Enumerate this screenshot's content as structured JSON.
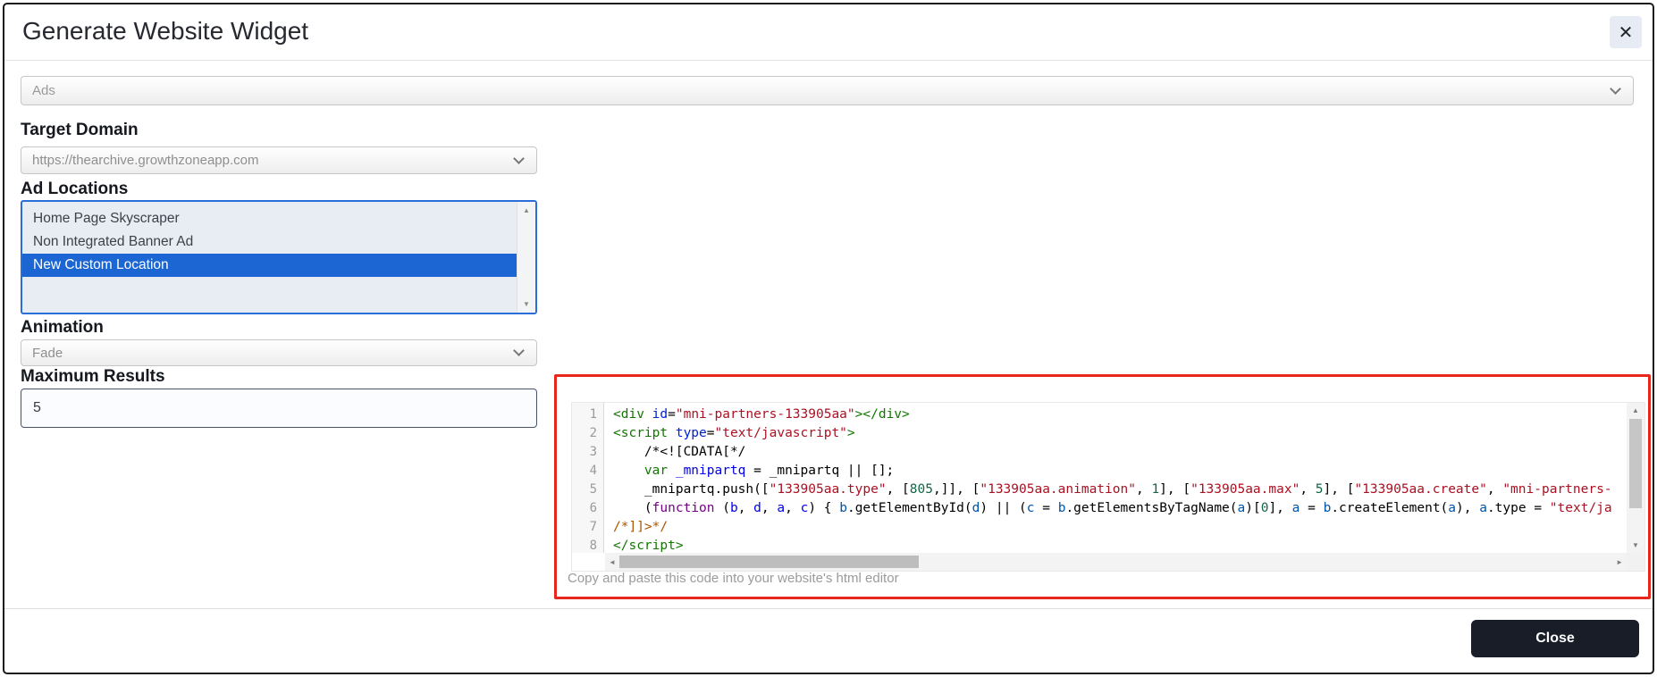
{
  "colors": {
    "accent_blue": "#1b66d2",
    "listbox_border_blue": "#2a6fd9",
    "annotation_red": "#e8271c",
    "close_button_bg": "#191d27"
  },
  "dialog": {
    "title": "Generate Website Widget",
    "close_icon": "✕"
  },
  "widget_type_select": {
    "value": "Ads"
  },
  "target_domain": {
    "label": "Target Domain",
    "value": "https://thearchive.growthzoneapp.com"
  },
  "ad_locations": {
    "label": "Ad Locations",
    "options": [
      {
        "label": "Home Page Skyscraper",
        "selected": false
      },
      {
        "label": "Non Integrated Banner Ad",
        "selected": false
      },
      {
        "label": "New Custom Location",
        "selected": true
      }
    ]
  },
  "animation": {
    "label": "Animation",
    "value": "Fade"
  },
  "maximum_results": {
    "label": "Maximum Results",
    "value": "5"
  },
  "code_widget": {
    "caption": "Copy and paste this code into your website's html editor",
    "palette": {
      "green": "#117700",
      "blue": "#0022cc",
      "red": "#aa1122",
      "teal": "#116644",
      "purple": "#770088",
      "orange": "#aa5500",
      "defblue": "#0000ee",
      "varblue": "#0055aa",
      "black": "#000000"
    },
    "lines": [
      {
        "n": "1",
        "segs": [
          [
            "green",
            "<div "
          ],
          [
            "blue",
            "id"
          ],
          [
            "black",
            "="
          ],
          [
            "red",
            "\"mni-partners-133905aa\""
          ],
          [
            "green",
            "></div>"
          ]
        ]
      },
      {
        "n": "2",
        "segs": [
          [
            "green",
            "<script "
          ],
          [
            "blue",
            "type"
          ],
          [
            "black",
            "="
          ],
          [
            "red",
            "\"text/javascript\""
          ],
          [
            "green",
            ">"
          ]
        ]
      },
      {
        "n": "3",
        "segs": [
          [
            "black",
            "    /*<![CDATA[*/"
          ]
        ]
      },
      {
        "n": "4",
        "segs": [
          [
            "green",
            "    var "
          ],
          [
            "defblue",
            "_mnipartq"
          ],
          [
            "black",
            " = _mnipartq || [];"
          ]
        ]
      },
      {
        "n": "5",
        "segs": [
          [
            "black",
            "    _mnipartq.push(["
          ],
          [
            "red",
            "\"133905aa.type\""
          ],
          [
            "black",
            ", ["
          ],
          [
            "teal",
            "805"
          ],
          [
            "black",
            ",]], ["
          ],
          [
            "red",
            "\"133905aa.animation\""
          ],
          [
            "black",
            ", "
          ],
          [
            "teal",
            "1"
          ],
          [
            "black",
            "], ["
          ],
          [
            "red",
            "\"133905aa.max\""
          ],
          [
            "black",
            ", "
          ],
          [
            "teal",
            "5"
          ],
          [
            "black",
            "], ["
          ],
          [
            "red",
            "\"133905aa.create\""
          ],
          [
            "black",
            ", "
          ],
          [
            "red",
            "\"mni-partners-"
          ]
        ]
      },
      {
        "n": "6",
        "segs": [
          [
            "black",
            "    ("
          ],
          [
            "purple",
            "function"
          ],
          [
            "black",
            " ("
          ],
          [
            "defblue",
            "b"
          ],
          [
            "black",
            ", "
          ],
          [
            "defblue",
            "d"
          ],
          [
            "black",
            ", "
          ],
          [
            "defblue",
            "a"
          ],
          [
            "black",
            ", "
          ],
          [
            "defblue",
            "c"
          ],
          [
            "black",
            ") { "
          ],
          [
            "varblue",
            "b"
          ],
          [
            "black",
            ".getElementById("
          ],
          [
            "varblue",
            "d"
          ],
          [
            "black",
            ") || ("
          ],
          [
            "varblue",
            "c"
          ],
          [
            "black",
            " = "
          ],
          [
            "varblue",
            "b"
          ],
          [
            "black",
            ".getElementsByTagName("
          ],
          [
            "varblue",
            "a"
          ],
          [
            "black",
            ")["
          ],
          [
            "teal",
            "0"
          ],
          [
            "black",
            "], "
          ],
          [
            "varblue",
            "a"
          ],
          [
            "black",
            " = "
          ],
          [
            "varblue",
            "b"
          ],
          [
            "black",
            ".createElement("
          ],
          [
            "varblue",
            "a"
          ],
          [
            "black",
            "), "
          ],
          [
            "varblue",
            "a"
          ],
          [
            "black",
            ".type = "
          ],
          [
            "red",
            "\"text/ja"
          ]
        ]
      },
      {
        "n": "7",
        "segs": [
          [
            "orange",
            "/*]]>*/"
          ]
        ]
      },
      {
        "n": "8",
        "segs": [
          [
            "green",
            "</script>"
          ]
        ]
      }
    ]
  },
  "scrollbar_icons": {
    "up": "▲",
    "down": "▼",
    "left": "◄",
    "right": "►"
  },
  "footer": {
    "close_label": "Close"
  }
}
